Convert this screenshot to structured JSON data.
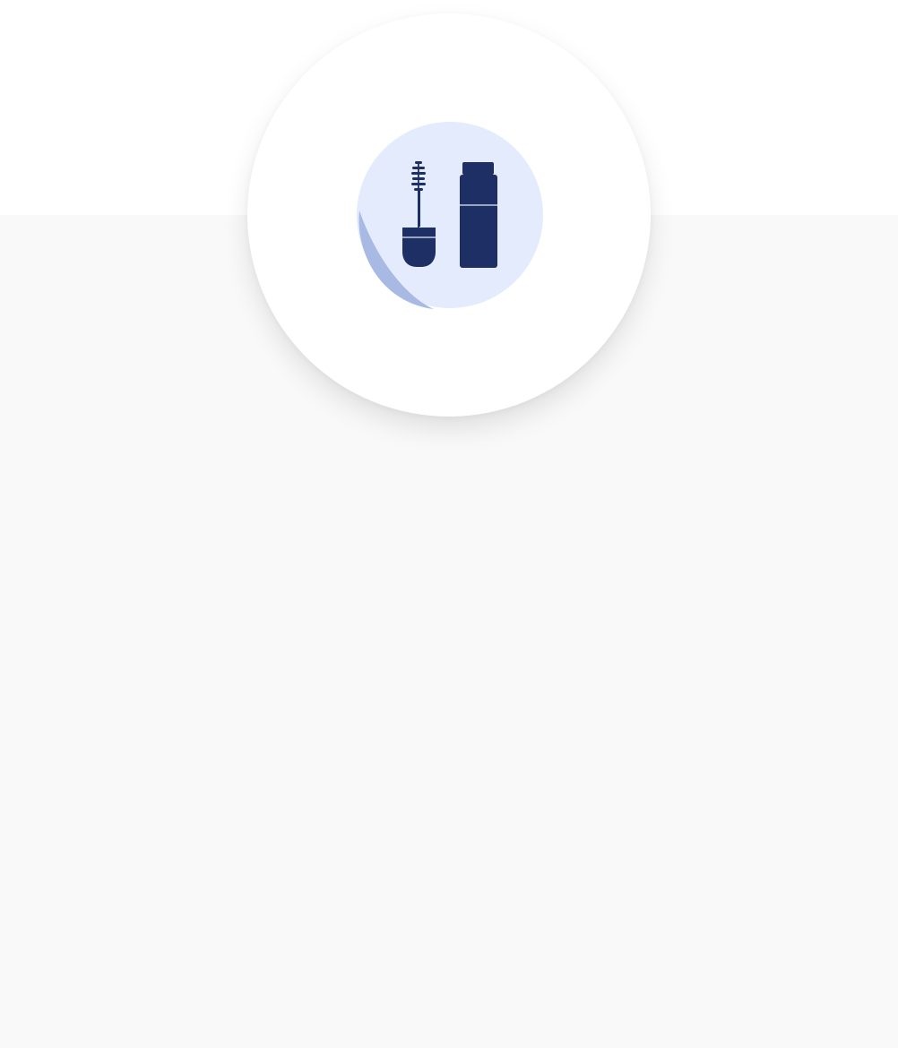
{
  "product_icon": {
    "name": "mascara-icon",
    "colors": {
      "circle_bg": "#e3ebfd",
      "accent": "#a8b9e3",
      "icon": "#1e2f66"
    }
  },
  "page": {
    "background": "#f9f9f9",
    "top_background": "#ffffff"
  }
}
